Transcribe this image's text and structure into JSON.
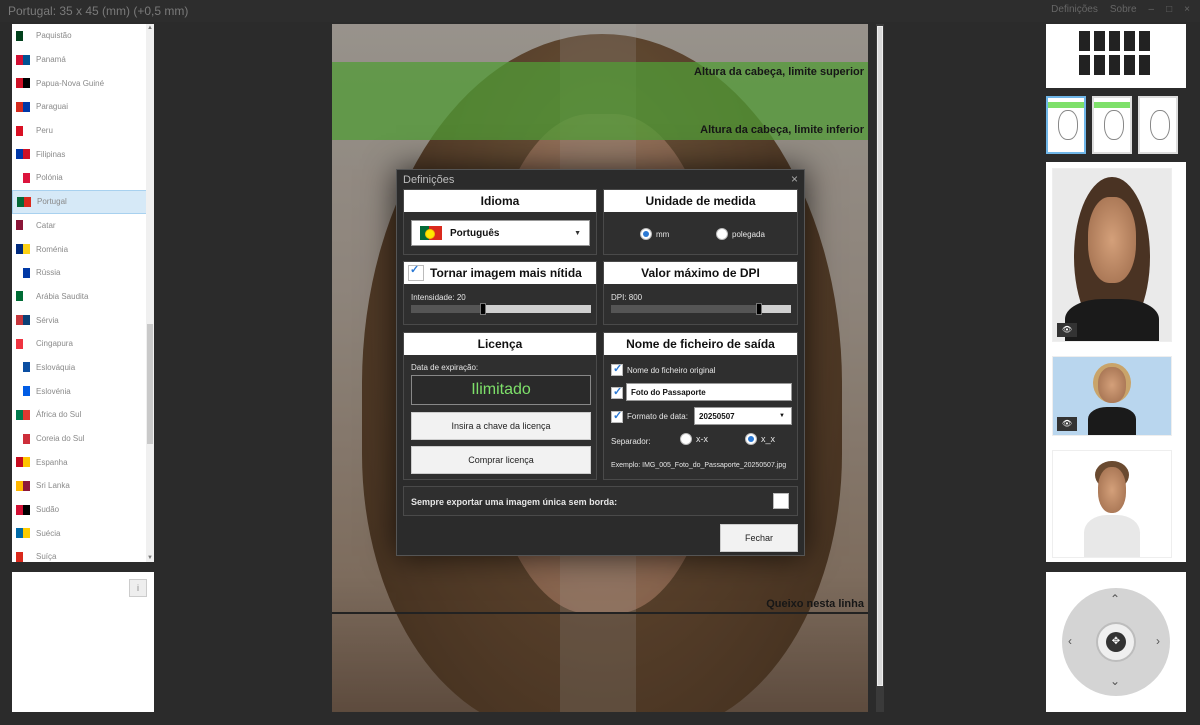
{
  "window": {
    "title": "Portugal: 35 x 45 (mm) (+0,5 mm)",
    "right_controls": [
      "Definições",
      "Sobre",
      "–",
      "□",
      "×"
    ]
  },
  "countries": [
    {
      "name": "Paquistão",
      "flag": [
        "#01411c",
        "#ffffff"
      ]
    },
    {
      "name": "Panamá",
      "flag": [
        "#d21034",
        "#005293"
      ]
    },
    {
      "name": "Papua-Nova Guiné",
      "flag": [
        "#ce1126",
        "#000000"
      ]
    },
    {
      "name": "Paraguai",
      "flag": [
        "#d52b1e",
        "#0038a8"
      ]
    },
    {
      "name": "Peru",
      "flag": [
        "#d91023",
        "#ffffff"
      ]
    },
    {
      "name": "Filipinas",
      "flag": [
        "#0038a8",
        "#ce1126"
      ]
    },
    {
      "name": "Polónia",
      "flag": [
        "#ffffff",
        "#dc143c"
      ]
    },
    {
      "name": "Portugal",
      "flag": [
        "#046a38",
        "#da291c"
      ],
      "selected": true
    },
    {
      "name": "Catar",
      "flag": [
        "#8a1538",
        "#ffffff"
      ]
    },
    {
      "name": "Roménia",
      "flag": [
        "#002b7f",
        "#fcd116"
      ]
    },
    {
      "name": "Rússia",
      "flag": [
        "#ffffff",
        "#0039a6"
      ]
    },
    {
      "name": "Arábia Saudita",
      "flag": [
        "#006c35",
        "#ffffff"
      ]
    },
    {
      "name": "Sérvia",
      "flag": [
        "#c6363c",
        "#0c4076"
      ]
    },
    {
      "name": "Cingapura",
      "flag": [
        "#ef3340",
        "#ffffff"
      ]
    },
    {
      "name": "Eslováquia",
      "flag": [
        "#ffffff",
        "#0b4ea2"
      ]
    },
    {
      "name": "Eslovénia",
      "flag": [
        "#ffffff",
        "#005ce5"
      ]
    },
    {
      "name": "África do Sul",
      "flag": [
        "#007a4d",
        "#de3831"
      ]
    },
    {
      "name": "Coreia do Sul",
      "flag": [
        "#ffffff",
        "#cd2e3a"
      ]
    },
    {
      "name": "Espanha",
      "flag": [
        "#c60b1e",
        "#ffc400"
      ]
    },
    {
      "name": "Sri Lanka",
      "flag": [
        "#ffb700",
        "#8d153a"
      ]
    },
    {
      "name": "Sudão",
      "flag": [
        "#d21034",
        "#000000"
      ]
    },
    {
      "name": "Suécia",
      "flag": [
        "#006aa7",
        "#fecc00"
      ]
    },
    {
      "name": "Suíça",
      "flag": [
        "#da291c",
        "#ffffff"
      ]
    }
  ],
  "photo_guides": {
    "top": "Altura da cabeça, limite superior",
    "bottom": "Altura da cabeça, limite inferior",
    "chin": "Queixo nesta linha"
  },
  "info_button": "i",
  "dialog": {
    "title": "Definições",
    "close": "×",
    "language": {
      "header": "Idioma",
      "selected": "Português"
    },
    "unit": {
      "header": "Unidade de medida",
      "options": [
        "mm",
        "polegada"
      ],
      "selected": "mm"
    },
    "sharpen": {
      "header": "Tornar imagem mais nítida",
      "checked": true,
      "label": "Intensidade: 20",
      "value": 20,
      "max": 100
    },
    "dpi": {
      "header": "Valor máximo de DPI",
      "label": "DPI: 800",
      "value": 800,
      "fraction": 0.82
    },
    "license": {
      "header": "Licença",
      "expiry_label": "Data de expiração:",
      "expiry_value": "Ilimitado",
      "enter_key": "Insira a chave da licença",
      "buy": "Comprar licença"
    },
    "output_name": {
      "header": "Nome de ficheiro de saída",
      "original_name_label": "Nome do ficheiro original",
      "original_name_checked": true,
      "custom_text_checked": true,
      "custom_text": "Foto do Passaporte",
      "date_format_label": "Formato de data:",
      "date_format_checked": true,
      "date_format": "20250507",
      "separator_label": "Separador:",
      "separator_options": [
        "x-x",
        "x_x"
      ],
      "separator_selected": "x_x",
      "example": "Exemplo: IMG_005_Foto_do_Passaporte_20250507.jpg"
    },
    "single_export": {
      "label": "Sempre exportar uma imagem única sem borda:",
      "checked": false
    },
    "close_button": "Fechar"
  },
  "colors": {
    "accent_green": "#7ee06a",
    "dialog_bg": "#2b2b2b",
    "selection_blue": "#2b79d4"
  }
}
